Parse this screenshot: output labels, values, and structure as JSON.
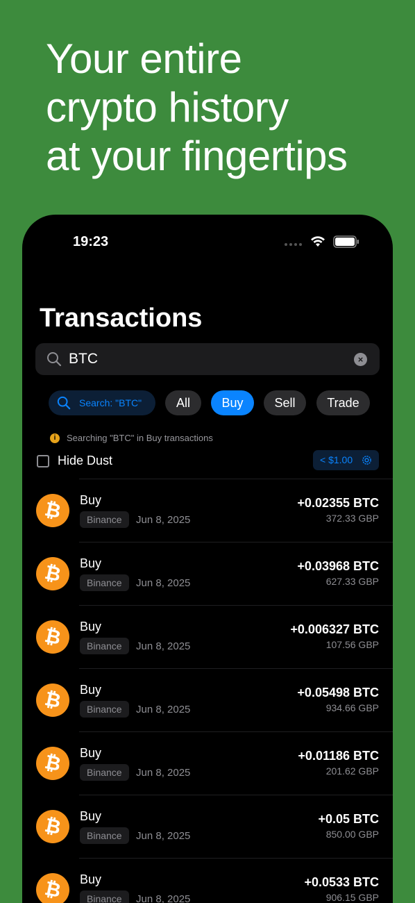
{
  "headline": [
    "Your entire",
    "crypto history",
    "at your fingertips"
  ],
  "status_bar": {
    "time": "19:23"
  },
  "page_title": "Transactions",
  "search": {
    "value": "BTC"
  },
  "filters": {
    "search_chip": "Search: \"BTC\"",
    "tabs": [
      "All",
      "Buy",
      "Sell",
      "Trade"
    ],
    "active_tab": "Buy"
  },
  "note": "Searching \"BTC\" in Buy transactions",
  "hide_dust": {
    "label": "Hide Dust",
    "checked": false,
    "threshold": "< $1.00"
  },
  "colors": {
    "background": "#3d8b3d",
    "accent": "#0a84ff",
    "bitcoin": "#f7931a"
  },
  "transactions": [
    {
      "type": "Buy",
      "source": "Binance",
      "date": "Jun 8, 2025",
      "amount": "+0.02355 BTC",
      "fiat": "372.33 GBP",
      "icon": "bitcoin-icon"
    },
    {
      "type": "Buy",
      "source": "Binance",
      "date": "Jun 8, 2025",
      "amount": "+0.03968 BTC",
      "fiat": "627.33 GBP",
      "icon": "bitcoin-icon"
    },
    {
      "type": "Buy",
      "source": "Binance",
      "date": "Jun 8, 2025",
      "amount": "+0.006327 BTC",
      "fiat": "107.56 GBP",
      "icon": "bitcoin-icon"
    },
    {
      "type": "Buy",
      "source": "Binance",
      "date": "Jun 8, 2025",
      "amount": "+0.05498 BTC",
      "fiat": "934.66 GBP",
      "icon": "bitcoin-icon"
    },
    {
      "type": "Buy",
      "source": "Binance",
      "date": "Jun 8, 2025",
      "amount": "+0.01186 BTC",
      "fiat": "201.62 GBP",
      "icon": "bitcoin-icon"
    },
    {
      "type": "Buy",
      "source": "Binance",
      "date": "Jun 8, 2025",
      "amount": "+0.05 BTC",
      "fiat": "850.00 GBP",
      "icon": "bitcoin-icon"
    },
    {
      "type": "Buy",
      "source": "Binance",
      "date": "Jun 8, 2025",
      "amount": "+0.0533 BTC",
      "fiat": "906.15 GBP",
      "icon": "bitcoin-icon"
    }
  ]
}
